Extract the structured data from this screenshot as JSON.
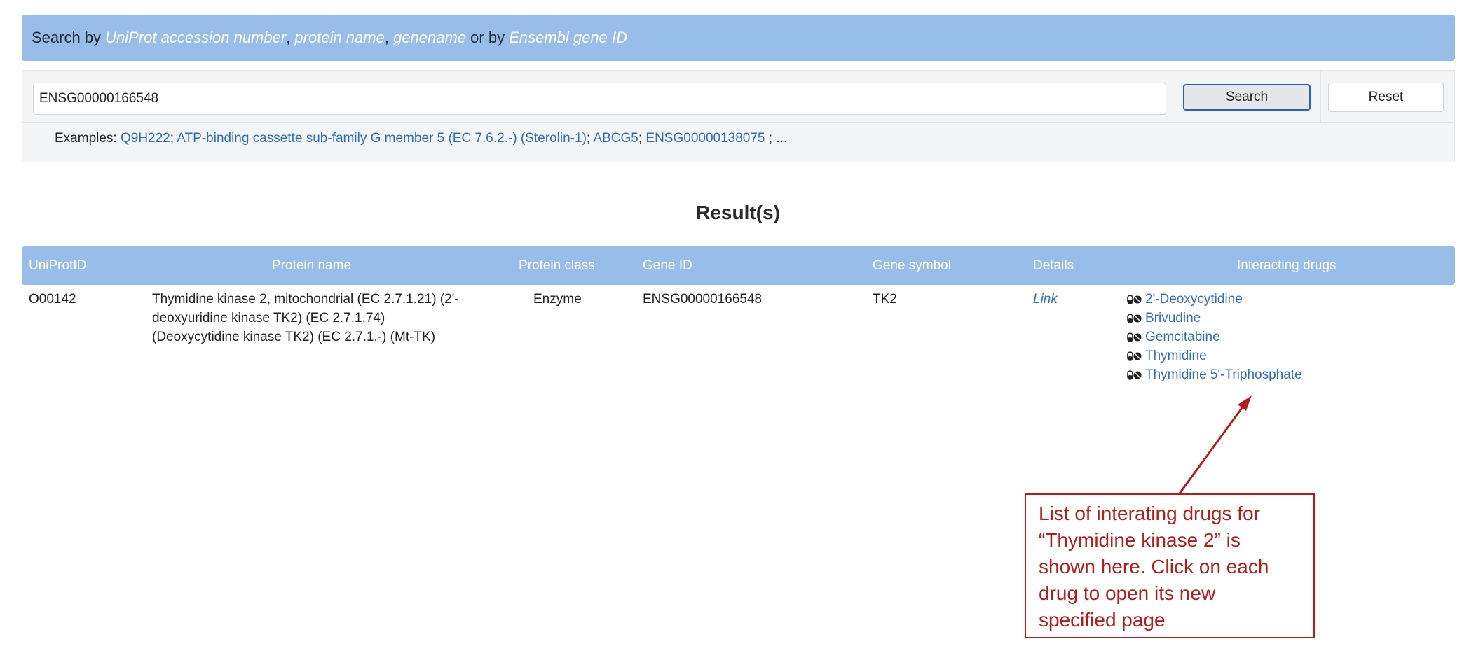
{
  "header": {
    "prefix": "Search by ",
    "term1": "UniProt accession number",
    "sep1": ", ",
    "term2": "protein name",
    "sep2": ", ",
    "term3": "genename",
    "sep3": " or by ",
    "term4": "Ensembl gene ID"
  },
  "search": {
    "value": "ENSG00000166548",
    "search_label": "Search",
    "reset_label": "Reset"
  },
  "examples": {
    "label": "Examples: ",
    "items": [
      "Q9H222",
      "ATP-binding cassette sub-family G member 5 (EC 7.6.2.-) (Sterolin-1)",
      "ABCG5",
      "ENSG00000138075"
    ],
    "sep": "; ",
    "tail": " ; ..."
  },
  "results": {
    "title": "Result(s)",
    "columns": [
      "UniProtID",
      "Protein name",
      "Protein class",
      "Gene ID",
      "Gene symbol",
      "Details",
      "Interacting drugs"
    ],
    "row": {
      "uniprot_id": "O00142",
      "protein_name_lines": [
        "Thymidine kinase 2, mitochondrial (EC 2.7.1.21) (2'-",
        "deoxyuridine kinase TK2) (EC 2.7.1.74)",
        "(Deoxycytidine kinase TK2) (EC 2.7.1.-) (Mt-TK)"
      ],
      "protein_class": "Enzyme",
      "gene_id": "ENSG00000166548",
      "gene_symbol": "TK2",
      "details_link": "Link",
      "drugs": [
        "2'-Deoxycytidine",
        "Brivudine",
        "Gemcitabine",
        "Thymidine",
        "Thymidine 5'-Triphosphate"
      ],
      "drug_icon": "pills-icon"
    }
  },
  "annotation": {
    "lines": [
      "List of interating drugs for",
      "“Thymidine kinase 2” is",
      "shown here. Click on each",
      "drug to open its new",
      "specified page"
    ],
    "color": "#b71c1c"
  },
  "colors": {
    "header_bg": "#99bde9",
    "link": "#2f6fb7",
    "panel_bg": "#f3f4f5"
  }
}
